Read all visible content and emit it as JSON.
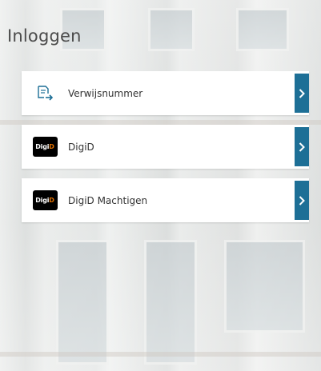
{
  "page": {
    "title": "Inloggen"
  },
  "login_options": [
    {
      "label": "Verwijsnummer",
      "icon": "document-arrow-icon"
    },
    {
      "label": "DigiD",
      "icon": "digid-logo",
      "logo_text_white": "Digi",
      "logo_text_orange": "D"
    },
    {
      "label": "DigiD Machtigen",
      "icon": "digid-logo",
      "logo_text_white": "Digi",
      "logo_text_orange": "D"
    }
  ],
  "colors": {
    "arrow_button": "#1d6f96",
    "digid_orange": "#e17000",
    "digid_black": "#000000",
    "title": "#4b4b4b"
  }
}
